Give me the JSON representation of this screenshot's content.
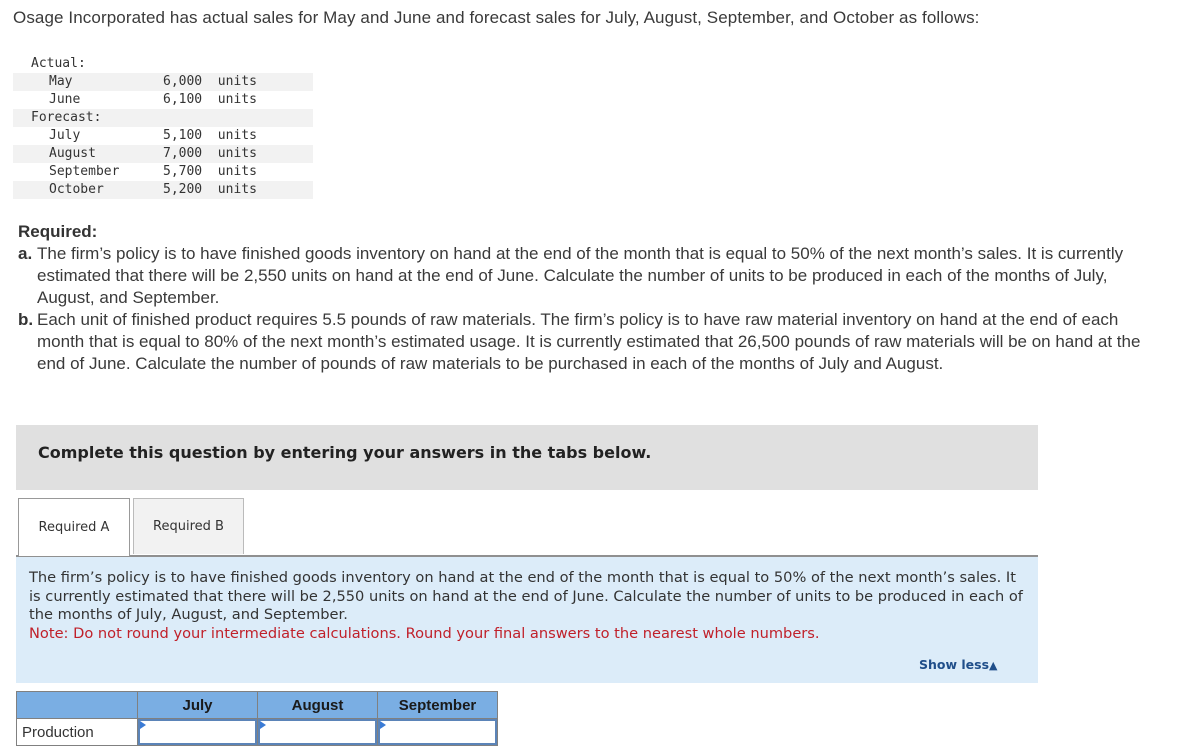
{
  "intro": "Osage Incorporated has actual sales for May and June and forecast sales for July, August, September, and October as follows:",
  "sales_table": {
    "actual_label": "Actual:",
    "forecast_label": "Forecast:",
    "actual": [
      {
        "month": "May",
        "value": "6,000",
        "unit": "units"
      },
      {
        "month": "June",
        "value": "6,100",
        "unit": "units"
      }
    ],
    "forecast": [
      {
        "month": "July",
        "value": "5,100",
        "unit": "units"
      },
      {
        "month": "August",
        "value": "7,000",
        "unit": "units"
      },
      {
        "month": "September",
        "value": "5,700",
        "unit": "units"
      },
      {
        "month": "October",
        "value": "5,200",
        "unit": "units"
      }
    ]
  },
  "required": {
    "title": "Required:",
    "items": [
      {
        "mark": "a.",
        "text": "The firm’s policy is to have finished goods inventory on hand at the end of the month that is equal to 50% of the next month’s sales. It is currently estimated that there will be 2,550 units on hand at the end of June. Calculate the number of units to be produced in each of the months of July, August, and September."
      },
      {
        "mark": "b.",
        "text": "Each unit of finished product requires 5.5 pounds of raw materials. The firm’s policy is to have raw material inventory on hand at the end of each month that is equal to 80% of the next month’s estimated usage. It is currently estimated that 26,500 pounds of raw materials will be on hand at the end of June. Calculate the number of pounds of raw materials to be purchased in each of the months of July and August."
      }
    ]
  },
  "banner": "Complete this question by entering your answers in the tabs below.",
  "tabs": [
    {
      "label": "Required A",
      "active": true
    },
    {
      "label": "Required B",
      "active": false
    }
  ],
  "panel": {
    "text": "The firm’s policy is to have finished goods inventory on hand at the end of the month that is equal to 50% of the next month’s sales. It is currently estimated that there will be 2,550 units on hand at the end of June. Calculate the number of units to be produced in each of the months of July, August, and September.",
    "note": "Note: Do not round your intermediate calculations. Round your final answers to the nearest whole numbers.",
    "show_less": "Show less",
    "show_less_icon": "triangle-up"
  },
  "answer_table": {
    "columns": [
      "July",
      "August",
      "September"
    ],
    "rows": [
      {
        "label": "Production",
        "values": [
          "",
          "",
          ""
        ]
      }
    ]
  },
  "colors": {
    "banner_bg": "#e0e0e0",
    "panel_bg": "#dcecf9",
    "note_red": "#c0202a",
    "header_blue": "#7aaee3",
    "link_blue": "#1f4e8a"
  }
}
